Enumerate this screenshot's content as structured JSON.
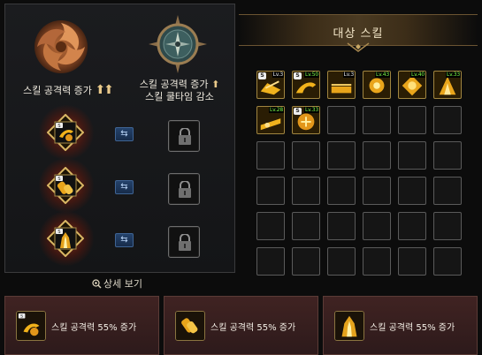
{
  "left_panel": {
    "bonus_a": {
      "label": "스킬 공격력 증가",
      "arrow": "⬆⬆"
    },
    "bonus_b": {
      "line1": "스킬 공격력 증가",
      "arrow": "⬆",
      "line2": "스킬 쿨타임 감소"
    },
    "rows": [
      {
        "swap_label": "⇆"
      },
      {
        "swap_label": "⇆"
      },
      {
        "swap_label": "⇆"
      }
    ],
    "detail_link": "상세 보기"
  },
  "target_skill": {
    "title": "대상 스킬",
    "skills": [
      {
        "badge": "S",
        "level": "Lv.3",
        "level_color": "white"
      },
      {
        "badge": "S",
        "level": "Lv.50",
        "level_color": "green"
      },
      {
        "badge": "",
        "level": "Lv.3",
        "level_color": "white"
      },
      {
        "badge": "",
        "level": "Lv.43",
        "level_color": "green"
      },
      {
        "badge": "",
        "level": "Lv.40",
        "level_color": "green"
      },
      {
        "badge": "",
        "level": "Lv.33",
        "level_color": "green"
      },
      {
        "badge": "",
        "level": "Lv.28",
        "level_color": "green"
      },
      {
        "badge": "S",
        "level": "Lv.33",
        "level_color": "green"
      }
    ]
  },
  "bottom_bars": [
    {
      "text": "스킬 공격력 55% 증가"
    },
    {
      "text": "스킬 공격력 55% 증가"
    },
    {
      "text": "스킬 공격력 55% 증가"
    }
  ],
  "colors": {
    "gold": "#d9a72a",
    "level_green": "#7dff4a",
    "bottom_card": "#402322",
    "swap_blue": "#24426b"
  }
}
